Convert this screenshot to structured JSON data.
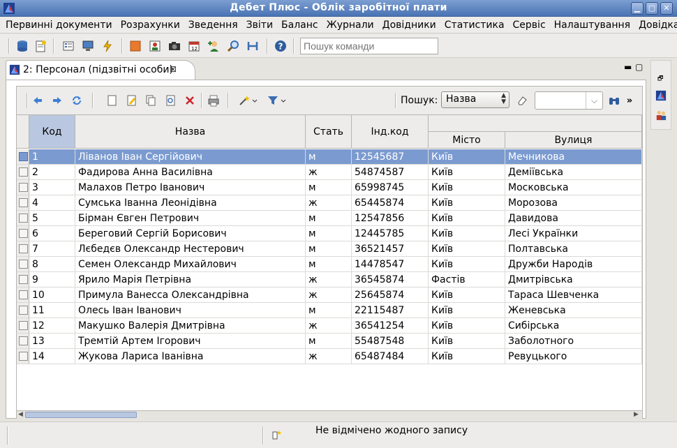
{
  "window": {
    "title": "Дебет Плюс - Облік заробітної плати",
    "minimize_glyph": "▁",
    "maximize_glyph": "▢",
    "close_glyph": "✕"
  },
  "menu": [
    "Первинні документи",
    "Розрахунки",
    "Зведення",
    "Звіти",
    "Баланс",
    "Журнали",
    "Довідники",
    "Статистика",
    "Сервіс",
    "Налаштування",
    "Довідка"
  ],
  "command_search": {
    "placeholder": "Пошук команди"
  },
  "tab": {
    "label": "2: Персонал (підзвітні особи)",
    "close_glyph": "⊠",
    "min_glyph": "▬",
    "max_glyph": "▢"
  },
  "search": {
    "label": "Пошук:",
    "field": "Назва",
    "value": ""
  },
  "columns": {
    "code": "Код",
    "name": "Назва",
    "sex": "Стать",
    "tax_id": "Інд.код",
    "city": "Місто",
    "street": "Вулиця"
  },
  "rows": [
    {
      "code": "1",
      "name": "Ліванов Іван Сергійович",
      "sex": "м",
      "tax_id": "12545687",
      "city": "Київ",
      "street": "Мечникова"
    },
    {
      "code": "2",
      "name": "Фадирова Анна Василівна",
      "sex": "ж",
      "tax_id": "54874587",
      "city": "Київ",
      "street": "Деміївська"
    },
    {
      "code": "3",
      "name": "Малахов Петро Іванович",
      "sex": "м",
      "tax_id": "65998745",
      "city": "Київ",
      "street": "Московська"
    },
    {
      "code": "4",
      "name": "Сумська Іванна Леонідівна",
      "sex": "ж",
      "tax_id": "65445874",
      "city": "Київ",
      "street": "Морозова"
    },
    {
      "code": "5",
      "name": "Бірман Євген Петрович",
      "sex": "м",
      "tax_id": "12547856",
      "city": "Київ",
      "street": "Давидова"
    },
    {
      "code": "6",
      "name": "Береговий Сергій Борисович",
      "sex": "м",
      "tax_id": "12445785",
      "city": "Київ",
      "street": "Лесі Українки"
    },
    {
      "code": "7",
      "name": "Лєбедєв Олександр Нестерович",
      "sex": "м",
      "tax_id": "36521457",
      "city": "Київ",
      "street": "Полтавська"
    },
    {
      "code": "8",
      "name": "Семен Олександр Михайлович",
      "sex": "м",
      "tax_id": "14478547",
      "city": "Київ",
      "street": "Дружби Народів"
    },
    {
      "code": "9",
      "name": "Ярило Марія Петрівна",
      "sex": "ж",
      "tax_id": "36545874",
      "city": "Фастів",
      "street": "Дмитрівська"
    },
    {
      "code": "10",
      "name": "Примула Ванесса Олександрівна",
      "sex": "ж",
      "tax_id": "25645874",
      "city": "Київ",
      "street": "Тараса Шевченка"
    },
    {
      "code": "11",
      "name": "Олесь Іван Іванович",
      "sex": "м",
      "tax_id": "22115487",
      "city": "Київ",
      "street": "Женевська"
    },
    {
      "code": "12",
      "name": "Макушко Валерія Дмитрівна",
      "sex": "ж",
      "tax_id": "36541254",
      "city": "Київ",
      "street": "Сибірська"
    },
    {
      "code": "13",
      "name": "Тремтій Артем Ігорович",
      "sex": "м",
      "tax_id": "55487548",
      "city": "Київ",
      "street": "Заболотного"
    },
    {
      "code": "14",
      "name": "Жукова Лариса Іванівна",
      "sex": "ж",
      "tax_id": "65487484",
      "city": "Київ",
      "street": "Ревуцького"
    }
  ],
  "selected_row": 0,
  "status": {
    "message": "Не відмічено жодного запису"
  },
  "colors": {
    "title_bar": "#4a73b3",
    "selection": "#7b9bd0",
    "active_header": "#b9c7e0",
    "delete": "#d0232a"
  }
}
